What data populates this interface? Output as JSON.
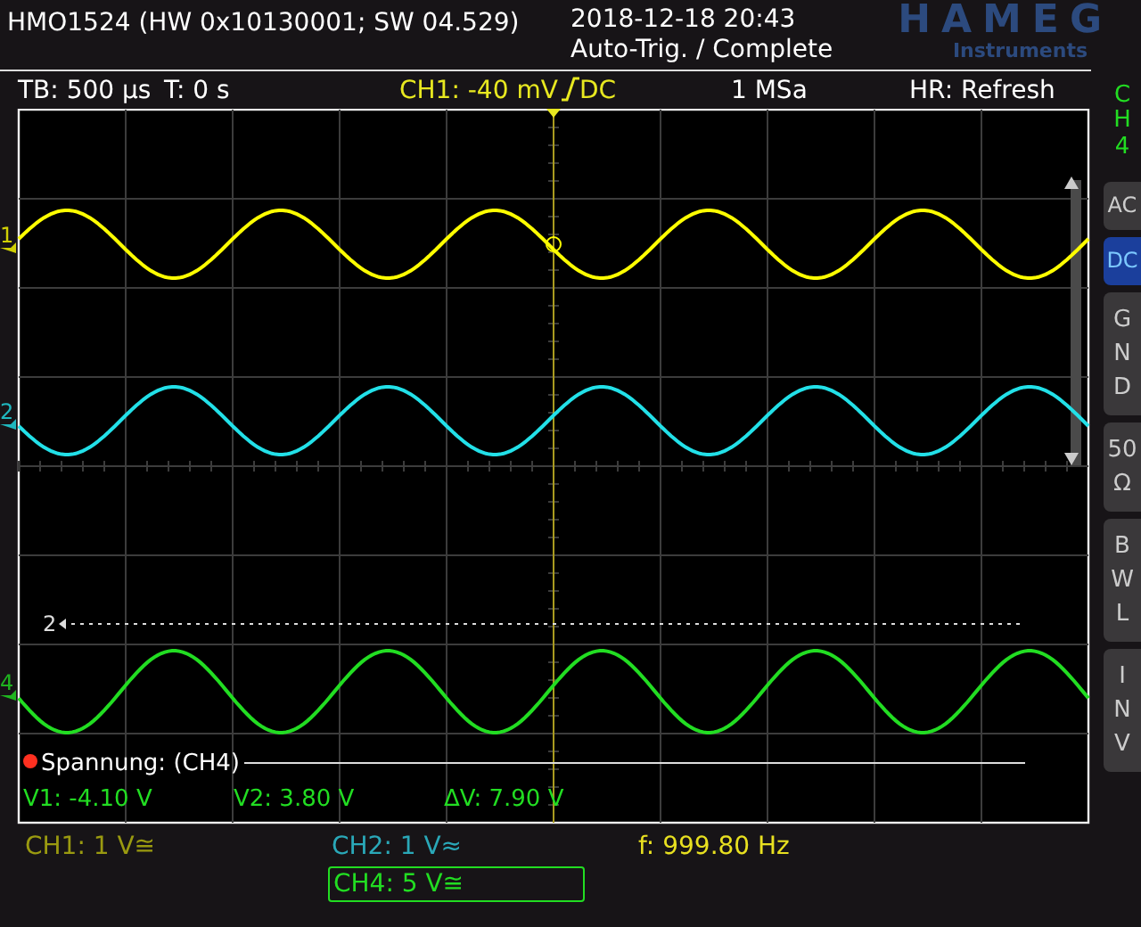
{
  "header": {
    "model": "HMO1524 (HW 0x10130001; SW 04.529)",
    "datetime": "2018-12-18 20:43",
    "status": "Auto-Trig. / Complete",
    "logo": "HAMEG",
    "logo_sub": "Instruments"
  },
  "info_bar": {
    "timebase": "TB: 500 µs",
    "trigger_time": "T: 0 s",
    "trigger_level": "CH1: -40 mV",
    "trigger_coupling": "DC",
    "sample_rate": "1 MSa",
    "mode": "HR: Refresh"
  },
  "channels": [
    {
      "label": "1",
      "color": "#ffff00"
    },
    {
      "label": "2",
      "color": "#22e0e8"
    },
    {
      "label": "4",
      "color": "#22dd22"
    }
  ],
  "reference_marker": {
    "label": "2"
  },
  "measurement": {
    "title": "Spannung: (CH4)",
    "v1": "V1: -4.10 V",
    "v2": "V2: 3.80 V",
    "delta": "ΔV: 7.90 V"
  },
  "side_menu": {
    "channel": "CH4",
    "buttons": [
      {
        "label": "AC",
        "selected": false
      },
      {
        "label": "DC",
        "selected": true
      },
      {
        "label": "GND",
        "selected": false
      },
      {
        "label": "50 Ω",
        "selected": false
      },
      {
        "label": "BWL",
        "selected": false
      },
      {
        "label": "INV",
        "selected": false
      }
    ]
  },
  "readouts": [
    {
      "text": "CH1: 1 V≅",
      "color": "#9a9a10",
      "selected": false
    },
    {
      "text": "CH2: 1 V≈",
      "color": "#2aa8b8",
      "selected": false
    },
    {
      "text": "f: 999.80 Hz",
      "color": "#e8e020",
      "selected": false
    },
    {
      "text": "CH4: 5 V≅",
      "color": "#22dd22",
      "selected": true
    }
  ]
}
